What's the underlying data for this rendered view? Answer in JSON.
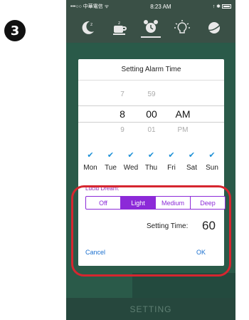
{
  "step_number": "3",
  "status_bar": {
    "carrier": "•••○○ 中華電信 ᯤ",
    "time": "8:23 AM",
    "right_icons": "↑ ✱"
  },
  "toolbar": {
    "icons": [
      "moon-icon",
      "coffee-cup-icon",
      "alarm-clock-icon",
      "lightbulb-icon",
      "globe-icon"
    ],
    "active_index": 2
  },
  "dialog": {
    "title": "Setting Alarm Time",
    "picker": {
      "hour_above": "7",
      "minute_above": "59",
      "hour_selected": "8",
      "minute_selected": "00",
      "ampm_selected": "AM",
      "hour_below": "9",
      "minute_below": "01",
      "ampm_below": "PM"
    },
    "days": [
      {
        "label": "Mon",
        "checked": true
      },
      {
        "label": "Tue",
        "checked": true
      },
      {
        "label": "Wed",
        "checked": true
      },
      {
        "label": "Thu",
        "checked": true
      },
      {
        "label": "Fri",
        "checked": true
      },
      {
        "label": "Sat",
        "checked": true
      },
      {
        "label": "Sun",
        "checked": true
      }
    ],
    "lucid_dream_label": "Lucid Dream:",
    "lucid_options": [
      "Off",
      "Light",
      "Medium",
      "Deep"
    ],
    "lucid_selected": "Light",
    "setting_time_label": "Setting Time:",
    "setting_time_value": "60",
    "cancel_label": "Cancel",
    "ok_label": "OK"
  },
  "bottom_bar": {
    "label": "SETTING"
  },
  "colors": {
    "accent": "#8c2ad8",
    "link": "#1a6fcf",
    "check": "#1a8fd6",
    "highlight": "#d6262f",
    "background": "#2f5b4c"
  }
}
